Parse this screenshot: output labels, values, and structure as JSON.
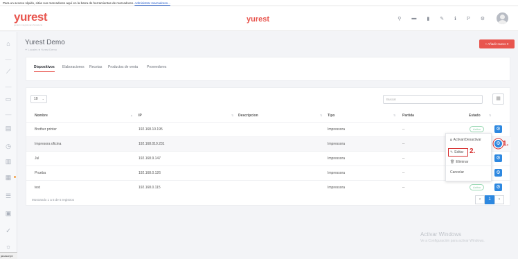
{
  "browser": {
    "bookmarks_text": "Para un acceso rápido, sitúe sus marcadores aquí en la barra de herramientas de marcadores.",
    "bookmarks_link": "Administrar marcadores..."
  },
  "header": {
    "logo": "yurest",
    "logo_tagline": "gestión integral para hostelería",
    "center_logo": "yurest",
    "icons": [
      "search-icon",
      "cart-icon",
      "document-icon",
      "pencil-icon",
      "info-icon",
      "help-icon",
      "gear-icon"
    ],
    "icon_glyphs": [
      "⚲",
      "▬",
      "▮",
      "✎",
      "ℹ",
      "ℙ",
      "⚙"
    ]
  },
  "sidebar": {
    "icons": [
      "home-icon",
      "chart-icon",
      "folder-icon",
      "store-icon",
      "clock-icon",
      "document-icon",
      "users-icon",
      "list-icon",
      "grid-icon",
      "check-icon",
      "bulb-icon"
    ],
    "glyphs": [
      "⌂",
      "⟋",
      "▭",
      "▤",
      "◷",
      "▥",
      "▦",
      "☰",
      "▣",
      "✓",
      "☼"
    ]
  },
  "page": {
    "title": "Yurest Demo",
    "breadcrumb": "✦ Locales ● Yurest Demo",
    "add_button": "+ Añadir nuevo ▾"
  },
  "tabs": [
    "Dispositivos",
    "Elaboraciones",
    "Recetas",
    "Productos de venta",
    "Proveedores"
  ],
  "table": {
    "page_length": "10",
    "search_placeholder": "Buscar",
    "columns": [
      "Nombre",
      "IP",
      "Descripcion",
      "Tipo",
      "Partida",
      "Estado"
    ],
    "rows": [
      {
        "name": "Brother printer",
        "ip": "192.168.10.195",
        "description": "",
        "type": "Impressora",
        "partida": "--",
        "estado": "Activo"
      },
      {
        "name": "Impresora oficina",
        "ip": "192.168.010.231",
        "description": "",
        "type": "Impressora",
        "partida": "--",
        "estado": ""
      },
      {
        "name": "Jul",
        "ip": "192.168.9.147",
        "description": "",
        "type": "Impressora",
        "partida": "--",
        "estado": ""
      },
      {
        "name": "Prueba",
        "ip": "192.168.0.126",
        "description": "",
        "type": "Impressora",
        "partida": "--",
        "estado": ""
      },
      {
        "name": "test",
        "ip": "192.168.0.115",
        "description": "",
        "type": "Impressora",
        "partida": "--",
        "estado": "Activo"
      }
    ],
    "info": "Mostrando 1 a 5 de 5 registros",
    "pager": {
      "prev": "‹",
      "current": "1",
      "next": "›"
    }
  },
  "dropdown": {
    "items": [
      "Activar/Desactivar",
      "Editar",
      "Eliminar",
      "Cancelar"
    ],
    "icons": [
      "lock-icon",
      "pencil-icon",
      "trash-icon"
    ]
  },
  "annotations": {
    "step1": "1.",
    "step2": "2."
  },
  "watermark": {
    "title": "Activar Windows",
    "subtitle": "Ve a Configuración para activar Windows."
  },
  "status_bar": "javascript:",
  "colors": {
    "brand": "#e8554e",
    "primary": "#2d88e0",
    "success": "#7ac79a",
    "annotation": "#d62c2c"
  }
}
